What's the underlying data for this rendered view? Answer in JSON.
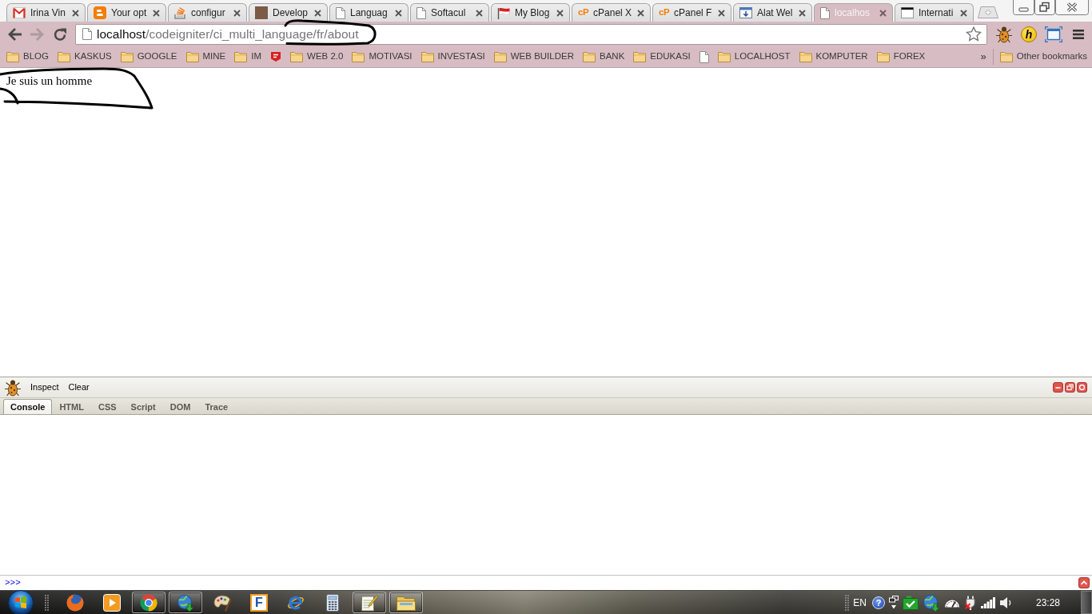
{
  "browser_tabs": [
    {
      "title": "Irina Vin",
      "kind": "mail",
      "selected": false
    },
    {
      "title": "Your opt",
      "kind": "blog",
      "selected": false
    },
    {
      "title": "configur",
      "kind": "stack",
      "selected": false
    },
    {
      "title": "Develop",
      "kind": "photo",
      "selected": false
    },
    {
      "title": "Languag",
      "kind": "page",
      "selected": false
    },
    {
      "title": "Softacul",
      "kind": "page",
      "selected": false
    },
    {
      "title": "My Blog",
      "kind": "flag",
      "selected": false
    },
    {
      "title": "cPanel X",
      "kind": "letters",
      "icon_text": "cP",
      "selected": false
    },
    {
      "title": "cPanel F",
      "kind": "letters",
      "icon_text": "cP",
      "selected": false
    },
    {
      "title": "Alat Wel",
      "kind": "tool",
      "selected": false
    },
    {
      "title": "localhos",
      "kind": "page",
      "selected": true
    },
    {
      "title": "Internati",
      "kind": "window",
      "selected": false
    }
  ],
  "navigation": [
    {
      "kind": "back",
      "disabled": false
    },
    {
      "kind": "forward",
      "disabled": true
    },
    {
      "kind": "reload",
      "disabled": false
    }
  ],
  "address_bar": {
    "host": "localhost",
    "path": "/codeigniter/ci_multi_language/fr/about"
  },
  "extensions": [
    {
      "kind": "bug"
    },
    {
      "kind": "letter",
      "text": "h"
    },
    {
      "kind": "frame"
    }
  ],
  "bookmarks": [
    {
      "label": "BLOG",
      "kind": "folder"
    },
    {
      "label": "KASKUS",
      "kind": "folder"
    },
    {
      "label": "GOOGLE",
      "kind": "folder"
    },
    {
      "label": "MINE",
      "kind": "folder"
    },
    {
      "label": "IM",
      "kind": "folder"
    },
    {
      "kind": "site"
    },
    {
      "label": "WEB 2.0",
      "kind": "folder"
    },
    {
      "label": "MOTIVASI",
      "kind": "folder"
    },
    {
      "label": "INVESTASI",
      "kind": "folder"
    },
    {
      "label": "WEB BUILDER",
      "kind": "folder"
    },
    {
      "label": "BANK",
      "kind": "folder"
    },
    {
      "label": "EDUKASI",
      "kind": "folder"
    },
    {
      "kind": "page"
    },
    {
      "label": "LOCALHOST",
      "kind": "folder"
    },
    {
      "label": "KOMPUTER",
      "kind": "folder"
    },
    {
      "label": "FOREX",
      "kind": "folder"
    }
  ],
  "bookmarks_overflow": "»",
  "other_bookmarks": "Other bookmarks",
  "page": {
    "text": "Je suis un homme"
  },
  "firebug": {
    "toolbar": [
      "Inspect",
      "Clear"
    ],
    "tabs": [
      {
        "label": "Console",
        "selected": true
      },
      {
        "label": "HTML",
        "selected": false
      },
      {
        "label": "CSS",
        "selected": false
      },
      {
        "label": "Script",
        "selected": false
      },
      {
        "label": "DOM",
        "selected": false
      },
      {
        "label": "Trace",
        "selected": false
      }
    ],
    "prompt": ">>>"
  },
  "taskbar": {
    "apps": [
      {
        "kind": "firefox",
        "running": false
      },
      {
        "kind": "media",
        "running": false
      },
      {
        "kind": "chrome",
        "running": true
      },
      {
        "kind": "download",
        "running": true
      },
      {
        "kind": "paint",
        "running": false
      },
      {
        "kind": "letter",
        "text": "F",
        "running": false
      },
      {
        "kind": "ie",
        "running": false
      },
      {
        "kind": "calculator",
        "running": false
      },
      {
        "kind": "notepad",
        "running": true
      },
      {
        "kind": "folder",
        "running": true
      }
    ],
    "tray": [
      {
        "kind": "text",
        "text": "EN"
      },
      {
        "kind": "help",
        "text": "?"
      },
      {
        "kind": "flyout"
      },
      {
        "kind": "check"
      },
      {
        "kind": "globe"
      },
      {
        "kind": "gauge"
      },
      {
        "kind": "power"
      },
      {
        "kind": "signal"
      },
      {
        "kind": "volume"
      }
    ],
    "clock": "23:28"
  }
}
